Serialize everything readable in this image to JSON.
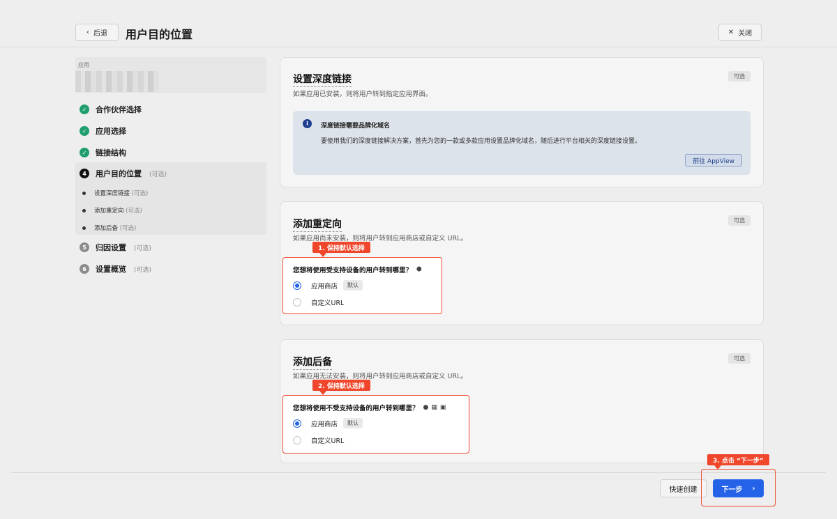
{
  "header": {
    "back_label": "后退",
    "title": "用户目的位置",
    "close_label": "关闭"
  },
  "sidebar": {
    "app_label": "应用",
    "steps": [
      {
        "num": "✓",
        "label": "合作伙伴选择",
        "optional": "",
        "state": "done"
      },
      {
        "num": "✓",
        "label": "应用选择",
        "optional": "",
        "state": "done"
      },
      {
        "num": "✓",
        "label": "链接结构",
        "optional": "",
        "state": "done"
      },
      {
        "num": "4",
        "label": "用户目的位置",
        "optional": "(可选)",
        "state": "current"
      },
      {
        "num": "5",
        "label": "归因设置",
        "optional": "(可选)",
        "state": "todo"
      },
      {
        "num": "6",
        "label": "设置概览",
        "optional": "(可选)",
        "state": "todo"
      }
    ],
    "substeps": [
      {
        "label": "设置深度链接",
        "optional": "(可选)"
      },
      {
        "label": "添加重定向",
        "optional": "(可选)"
      },
      {
        "label": "添加后备",
        "optional": "(可选)"
      }
    ]
  },
  "deeplink": {
    "title": "设置深度链接",
    "desc": "如果应用已安装，则将用户转到指定应用界面。",
    "badge": "可选",
    "info_title": "深度链接需要品牌化域名",
    "info_text": "要使用我们的深度链接解决方案，首先为您的一款或多款应用设置品牌化域名，随后进行平台相关的深度链接设置。",
    "info_link": "前往 AppView"
  },
  "redirect": {
    "title": "添加重定向",
    "desc": "如果应用尚未安装，则将用户转到应用商店或自定义 URL。",
    "badge": "可选",
    "callout": "1. 保持默认选择",
    "question": "您想将使用受支持设备的用户转到哪里？",
    "option1": "应用商店",
    "default_badge": "默认",
    "option2": "自定义URL"
  },
  "fallback": {
    "title": "添加后备",
    "desc": "如果应用无法安装，则将用户转到应用商店或自定义 URL。",
    "badge": "可选",
    "callout": "2. 保持默认选择",
    "question": "您想将使用不受支持设备的用户转到哪里？",
    "option1": "应用商店",
    "default_badge": "默认",
    "option2": "自定义URL"
  },
  "footer": {
    "quick_create": "快速创建",
    "next_label": "下一步",
    "callout": "3. 点击 “下一步”"
  },
  "colors": {
    "accent": "#2463e8",
    "annotation": "#f0462b",
    "done": "#1f9e6e"
  }
}
